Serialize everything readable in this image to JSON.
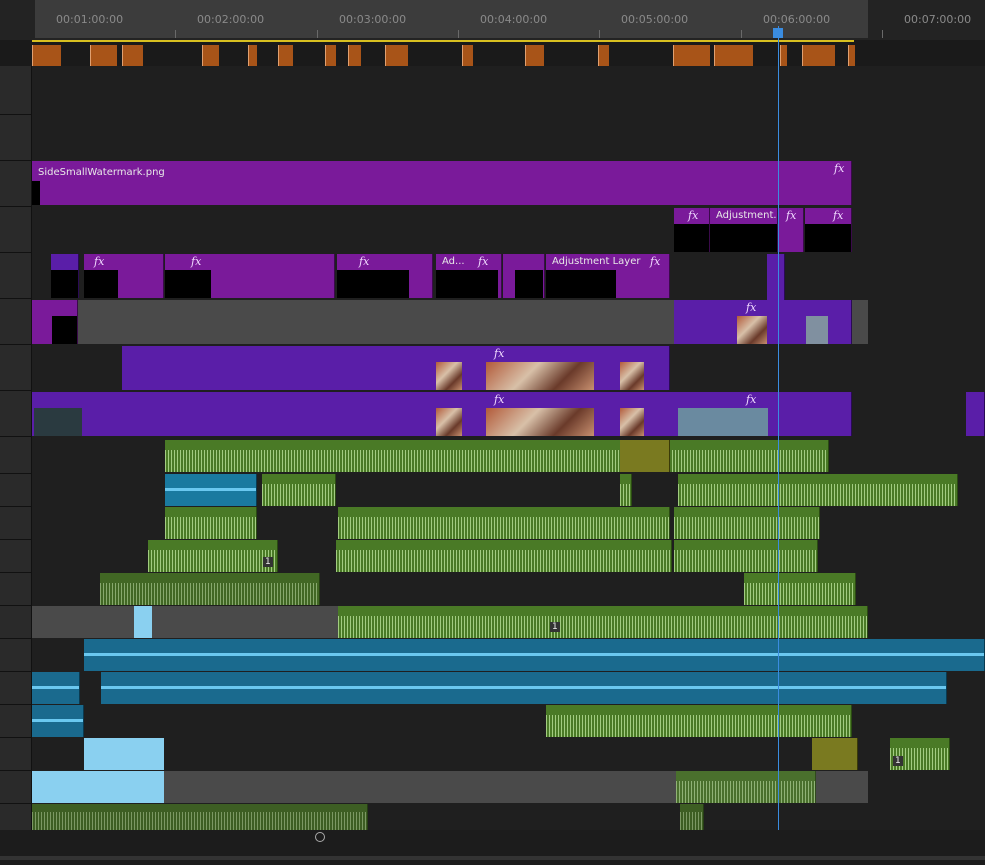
{
  "ruler": {
    "timecodes": [
      "00:01:00:00",
      "00:02:00:00",
      "00:03:00:00",
      "00:04:00:00",
      "00:05:00:00",
      "00:06:00:00",
      "00:07:00:00"
    ]
  },
  "clips": {
    "watermark_label": "SideSmallWatermark.png",
    "adjustment_truncated": "Adjustment...",
    "adjustment_layer": "Adjustment Layer",
    "adjustment_short": "Ad...",
    "fx": "fx"
  },
  "badges": {
    "audio_marker": "1"
  },
  "colors": {
    "video_clip": "#5a1ea8",
    "adjustment_clip": "#7a1a9a",
    "audio_clip": "#4a7a26",
    "music_clip": "#1a6a8e",
    "playhead": "#3a8ce0",
    "marker": "#a85418"
  }
}
